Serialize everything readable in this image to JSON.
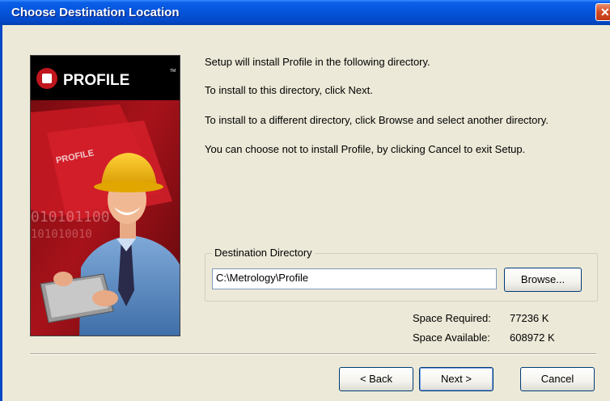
{
  "window": {
    "title": "Choose Destination Location",
    "close_label": "✕"
  },
  "art": {
    "brand": "PROFILE",
    "tm": "TM",
    "folder_text": "PROFILE",
    "binary_line1": "010101100",
    "binary_line2": "101010010"
  },
  "messages": {
    "line1": "Setup will install Profile in the following directory.",
    "line2": "To install to this directory, click Next.",
    "line3": "To install to a different directory, click Browse and select another directory.",
    "line4": "You can choose not to install Profile, by clicking Cancel to exit Setup."
  },
  "destination": {
    "group_label": "Destination Directory",
    "path": "C:\\Metrology\\Profile",
    "browse_label": "Browse..."
  },
  "space": {
    "required_label": "Space Required:",
    "required_value": "77236 K",
    "available_label": "Space Available:",
    "available_value": "608972 K"
  },
  "buttons": {
    "back": "< Back",
    "next": "Next >",
    "cancel": "Cancel"
  }
}
